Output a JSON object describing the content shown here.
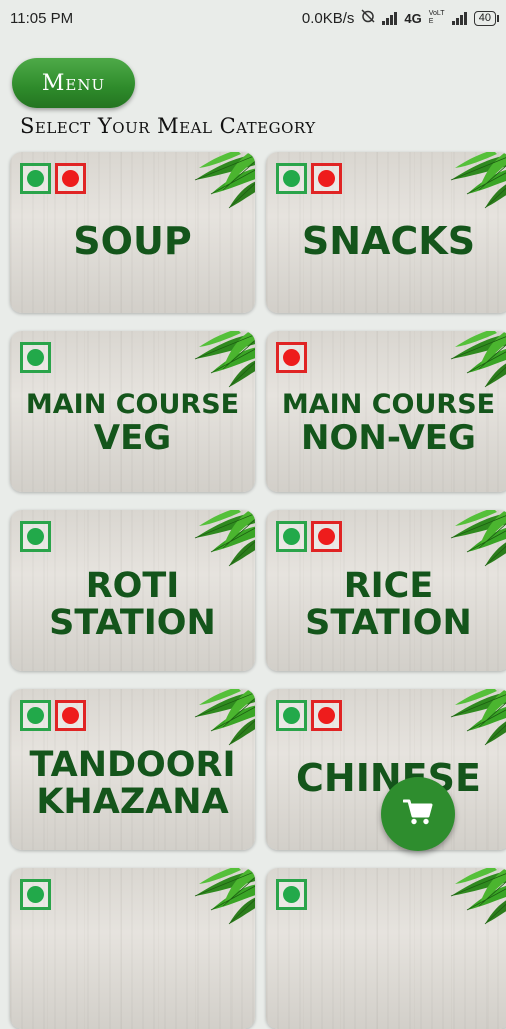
{
  "status_bar": {
    "time": "11:05 PM",
    "network_speed": "0.0KB/s",
    "network_type": "4G",
    "volte_label": "VoLTE",
    "battery": "40"
  },
  "menu_button": {
    "label": "Menu"
  },
  "section_title": "Select Your Meal Category",
  "categories": [
    {
      "line1": "SOUP",
      "line2": "",
      "veg": true,
      "nonveg": true
    },
    {
      "line1": "SNACKS",
      "line2": "",
      "veg": true,
      "nonveg": true
    },
    {
      "line1": "MAIN COURSE",
      "line2": "VEG",
      "veg": true,
      "nonveg": false
    },
    {
      "line1": "MAIN COURSE",
      "line2": "NON-VEG",
      "veg": false,
      "nonveg": true
    },
    {
      "line1": "ROTI",
      "line2": "STATION",
      "veg": true,
      "nonveg": false
    },
    {
      "line1": "RICE",
      "line2": "STATION",
      "veg": true,
      "nonveg": true
    },
    {
      "line1": "TANDOORI",
      "line2": "KHAZANA",
      "veg": true,
      "nonveg": true
    },
    {
      "line1": "CHINESE",
      "line2": "",
      "veg": true,
      "nonveg": true
    },
    {
      "line1": "",
      "line2": "",
      "veg": true,
      "nonveg": false
    },
    {
      "line1": "",
      "line2": "",
      "veg": true,
      "nonveg": false
    }
  ],
  "icons": {
    "cart": "shopping-cart-icon",
    "leaves": "leaves-icon",
    "veg": "veg-indicator-icon",
    "nonveg": "nonveg-indicator-icon"
  },
  "colors": {
    "accent_green": "#2e8d2e",
    "label_green": "#14551b",
    "veg_green": "#22a94a",
    "nonveg_red": "#ee1c1c"
  }
}
